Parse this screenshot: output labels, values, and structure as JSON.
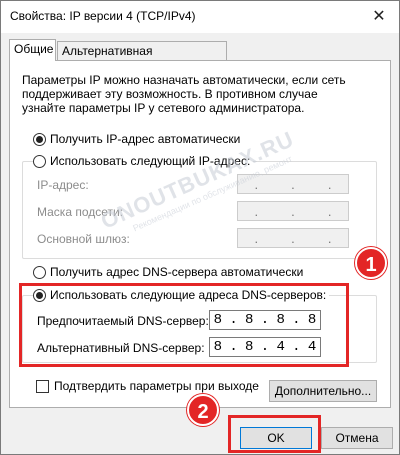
{
  "window": {
    "title": "Свойства: IP версии 4 (TCP/IPv4)",
    "close_glyph": "✕"
  },
  "tabs": [
    {
      "label": "Общие",
      "active": true
    },
    {
      "label": "Альтернативная конфигурация",
      "active": false
    }
  ],
  "description": "Параметры IP можно назначать автоматически, если сеть поддерживает эту возможность. В противном случае узнайте параметры IP у сетевого администратора.",
  "ip": {
    "auto_label": "Получить IP-адрес автоматически",
    "manual_label": "Использовать следующий IP-адрес:",
    "fields": [
      {
        "label": "IP-адрес:"
      },
      {
        "label": "Маска подсети:"
      },
      {
        "label": "Основной шлюз:"
      }
    ]
  },
  "dns": {
    "auto_label": "Получить адрес DNS-сервера автоматически",
    "manual_label": "Использовать следующие адреса DNS-серверов:",
    "preferred_label": "Предпочитаемый DNS-сервер:",
    "preferred_octets": [
      "8",
      "8",
      "8",
      "8"
    ],
    "alternate_label": "Альтернативный DNS-сервер:",
    "alternate_octets": [
      "8",
      "8",
      "4",
      "4"
    ]
  },
  "confirm_label": "Подтвердить параметры при выходе",
  "buttons": {
    "advanced": "Дополнительно...",
    "ok": "OK",
    "cancel": "Отмена"
  },
  "badges": [
    "1",
    "2"
  ],
  "watermark": {
    "main": "ONOUTBUKAX.RU",
    "sub": "Рекомендации по обслуживанию, ремонт"
  },
  "colors": {
    "highlight": "#e32626",
    "accent": "#0078d7"
  }
}
